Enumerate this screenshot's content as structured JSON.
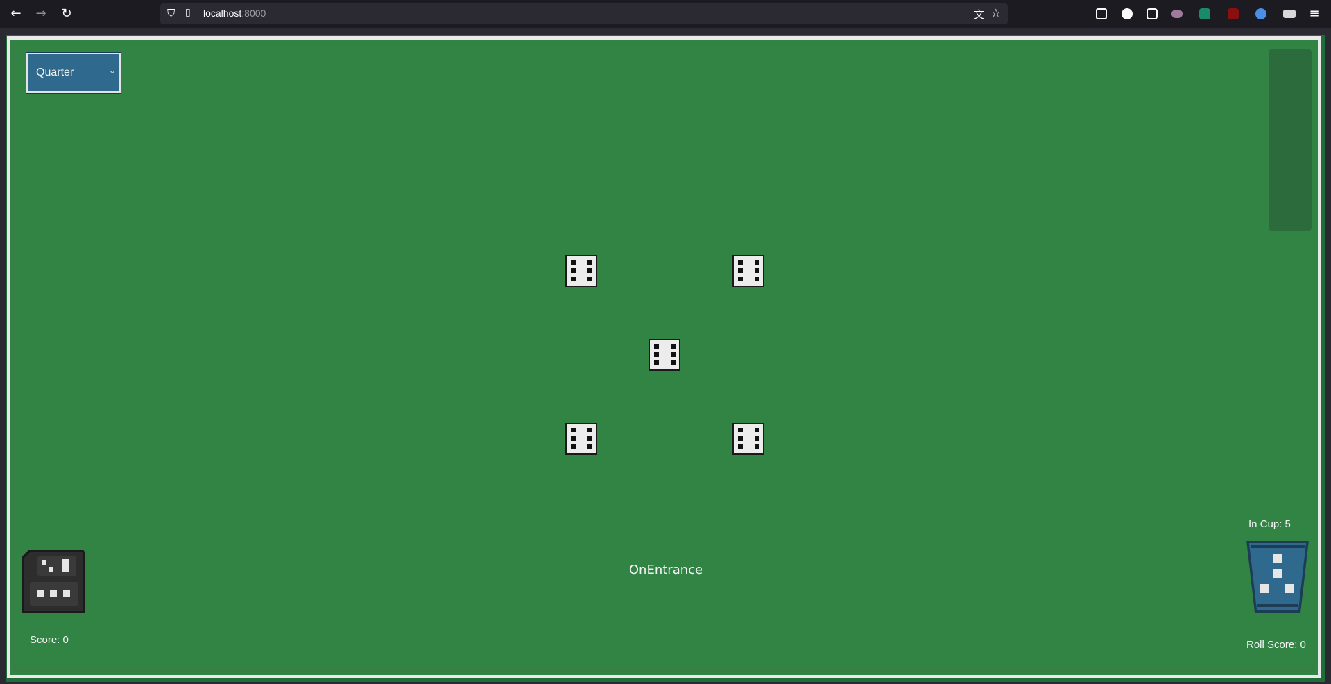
{
  "browser": {
    "url_host": "localhost",
    "url_port": ":8000"
  },
  "game": {
    "mode_select": {
      "selected": "Quarter",
      "icon": "chevron-down-icon"
    },
    "status_text": "OnEntrance",
    "score_text": "Score: 0",
    "roll_score_text": "Roll Score: 0",
    "in_cup_text": "In Cup: 5",
    "dice": [
      {
        "value": 6
      },
      {
        "value": 6
      },
      {
        "value": 6
      },
      {
        "value": 6
      },
      {
        "value": 6
      }
    ],
    "colors": {
      "table": "#328445",
      "frame": "#eaeaea",
      "select": "#2f6a8e",
      "cup": "#2f6a8e"
    }
  }
}
